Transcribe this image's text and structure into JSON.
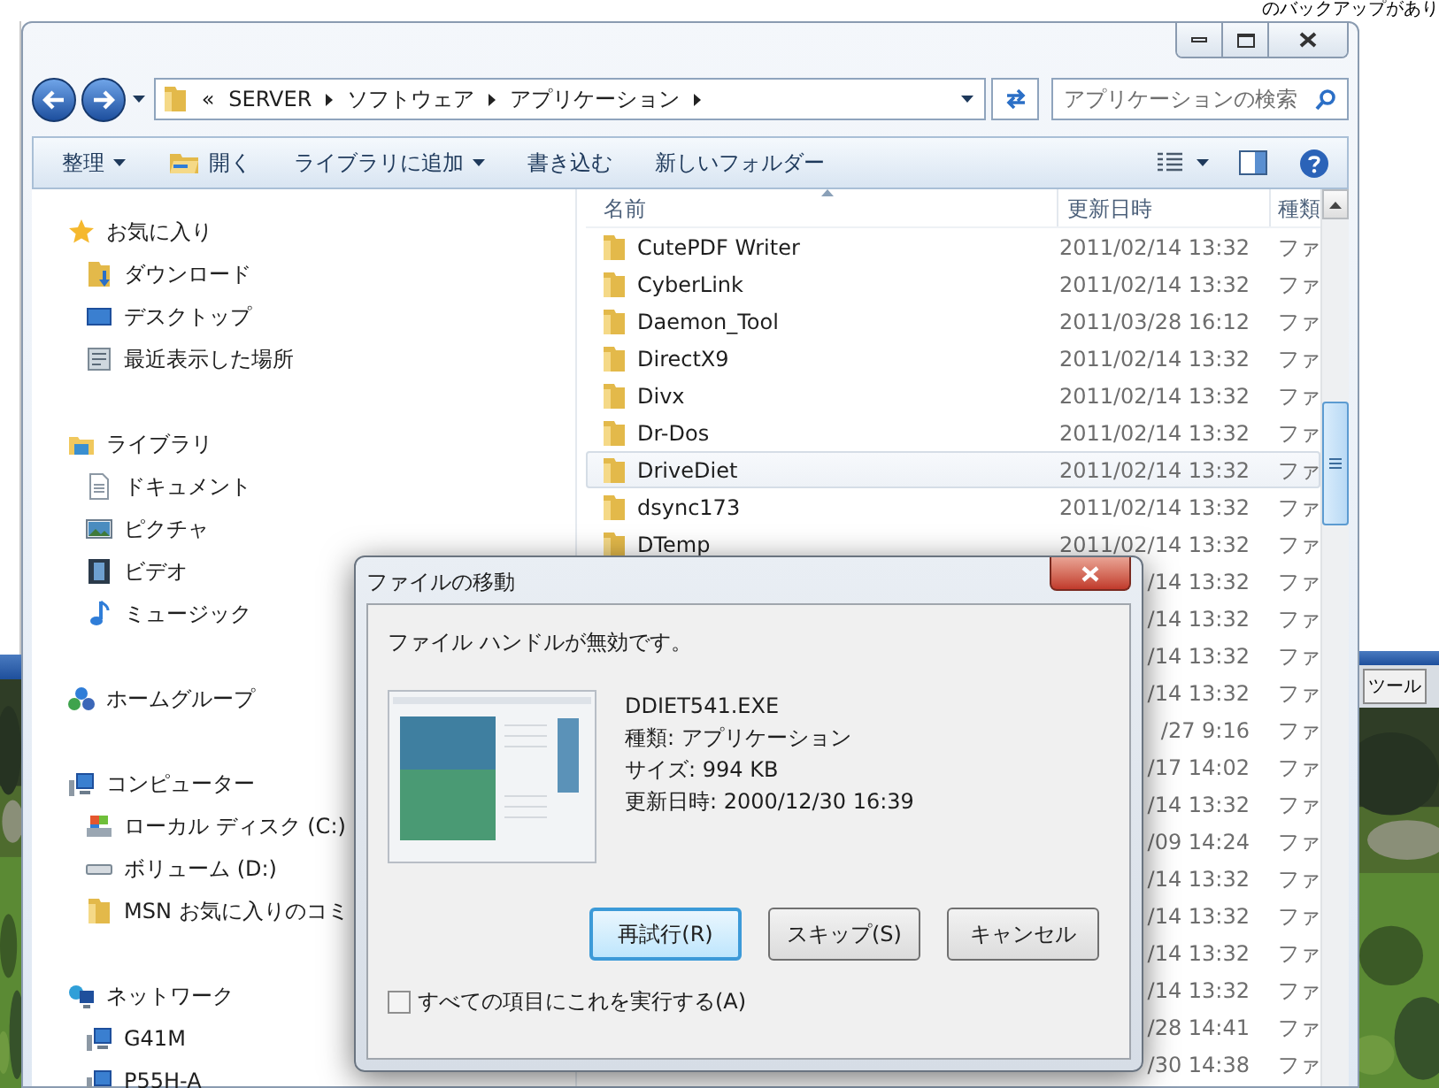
{
  "background_window": {
    "text": "のバックアップがあり"
  },
  "background_taskbar": {
    "tab": "ツール"
  },
  "explorer": {
    "breadcrumb_overflow": "«",
    "breadcrumb": [
      "SERVER",
      "ソフトウェア",
      "アプリケーション"
    ],
    "search": {
      "placeholder": "アプリケーションの検索"
    },
    "toolbar": [
      {
        "label": "整理",
        "kind": "menu"
      },
      {
        "label": "開く",
        "kind": "open"
      },
      {
        "label": "ライブラリに追加",
        "kind": "menu"
      },
      {
        "label": "書き込む",
        "kind": "plain"
      },
      {
        "label": "新しいフォルダー",
        "kind": "plain"
      }
    ],
    "nav": [
      {
        "label": "お気に入り",
        "kind": "star",
        "children": [
          {
            "label": "ダウンロード",
            "kind": "download"
          },
          {
            "label": "デスクトップ",
            "kind": "desktop"
          },
          {
            "label": "最近表示した場所",
            "kind": "recent"
          }
        ]
      },
      {
        "label": "ライブラリ",
        "kind": "library",
        "children": [
          {
            "label": "ドキュメント",
            "kind": "document"
          },
          {
            "label": "ピクチャ",
            "kind": "picture"
          },
          {
            "label": "ビデオ",
            "kind": "video"
          },
          {
            "label": "ミュージック",
            "kind": "music"
          }
        ]
      },
      {
        "label": "ホームグループ",
        "kind": "homegroup"
      },
      {
        "label": "コンピューター",
        "kind": "computer",
        "children": [
          {
            "label": "ローカル ディスク (C:)",
            "kind": "disk"
          },
          {
            "label": "ボリューム (D:)",
            "kind": "drive"
          },
          {
            "label": "MSN お気に入りのコミ",
            "kind": "folder"
          }
        ]
      },
      {
        "label": "ネットワーク",
        "kind": "network",
        "children": [
          {
            "label": "G41M",
            "kind": "pc"
          },
          {
            "label": "P55H-A",
            "kind": "pc"
          }
        ]
      }
    ],
    "columns": [
      "名前",
      "更新日時",
      "種類"
    ],
    "rows": [
      {
        "name": "CutePDF Writer",
        "date": "2011/02/14 13:32",
        "type": "ファ",
        "selected": false
      },
      {
        "name": "CyberLink",
        "date": "2011/02/14 13:32",
        "type": "ファ",
        "selected": false
      },
      {
        "name": "Daemon_Tool",
        "date": "2011/03/28 16:12",
        "type": "ファ",
        "selected": false
      },
      {
        "name": "DirectX9",
        "date": "2011/02/14 13:32",
        "type": "ファ",
        "selected": false
      },
      {
        "name": "Divx",
        "date": "2011/02/14 13:32",
        "type": "ファ",
        "selected": false
      },
      {
        "name": "Dr-Dos",
        "date": "2011/02/14 13:32",
        "type": "ファ",
        "selected": false
      },
      {
        "name": "DriveDiet",
        "date": "2011/02/14 13:32",
        "type": "ファ",
        "selected": true
      },
      {
        "name": "dsync173",
        "date": "2011/02/14 13:32",
        "type": "ファ",
        "selected": false
      },
      {
        "name": "DTemp",
        "date": "2011/02/14 13:32",
        "type": "ファ",
        "selected": false
      },
      {
        "date": "/14 13:32",
        "type": "ファ",
        "selected": false
      },
      {
        "date": "/14 13:32",
        "type": "ファ",
        "selected": false
      },
      {
        "date": "/14 13:32",
        "type": "ファ",
        "selected": false
      },
      {
        "date": "/14 13:32",
        "type": "ファ",
        "selected": false
      },
      {
        "date": "/27 9:16",
        "type": "ファ",
        "selected": false
      },
      {
        "date": "/17 14:02",
        "type": "ファ",
        "selected": false
      },
      {
        "date": "/14 13:32",
        "type": "ファ",
        "selected": false
      },
      {
        "date": "/09 14:24",
        "type": "ファ",
        "selected": false
      },
      {
        "date": "/14 13:32",
        "type": "ファ",
        "selected": false
      },
      {
        "date": "/14 13:32",
        "type": "ファ",
        "selected": false
      },
      {
        "date": "/14 13:32",
        "type": "ファ",
        "selected": false
      },
      {
        "date": "/14 13:32",
        "type": "ファ",
        "selected": false
      },
      {
        "date": "/28 14:41",
        "type": "ファ",
        "selected": false
      },
      {
        "date": "/30 14:38",
        "type": "ファ",
        "selected": false
      }
    ]
  },
  "dialog": {
    "title": "ファイルの移動",
    "message": "ファイル ハンドルが無効です。",
    "file": {
      "name": "DDIET541.EXE",
      "details": [
        "種類: アプリケーション",
        "サイズ: 994 KB",
        "更新日時: 2000/12/30 16:39"
      ]
    },
    "buttons": [
      {
        "label": "再試行(R)",
        "default": true
      },
      {
        "label": "スキップ(S)",
        "default": false
      },
      {
        "label": "キャンセル",
        "default": false
      }
    ],
    "apply_all": {
      "label": "すべての項目にこれを実行する(A)",
      "checked": false
    }
  }
}
